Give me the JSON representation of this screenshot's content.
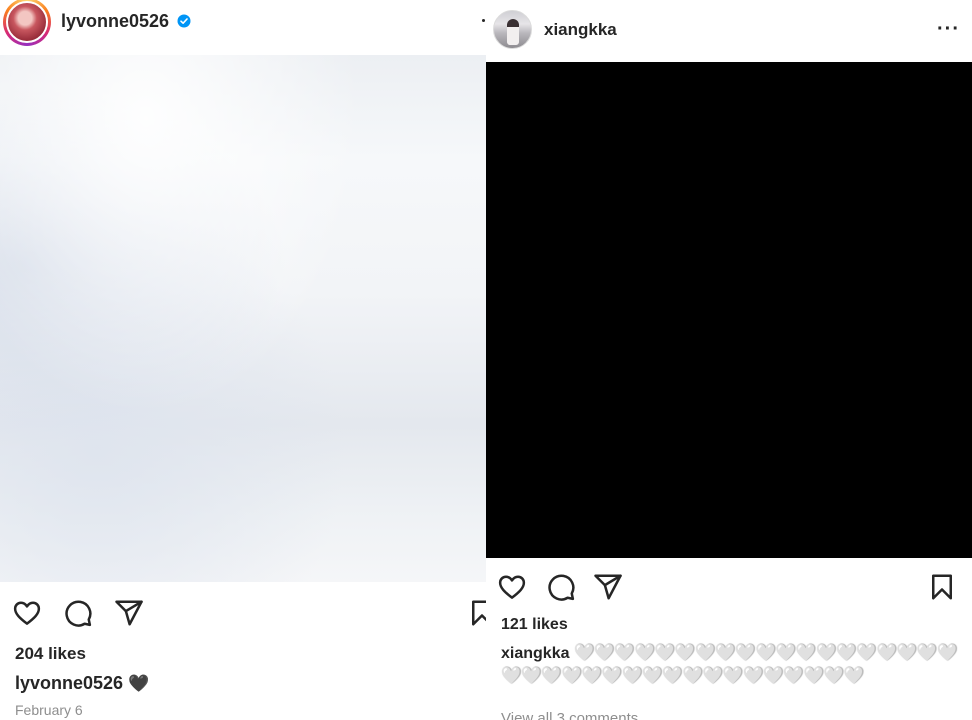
{
  "left_post": {
    "username": "lyvonne0526",
    "verified": true,
    "likes": "204 likes",
    "caption_user": "lyvonne0526",
    "caption_text": "🖤",
    "date": "February 6",
    "icons": [
      "heart-icon",
      "comment-icon",
      "share-icon",
      "bookmark-icon"
    ]
  },
  "right_post": {
    "username": "xiangkka",
    "more_label": "···",
    "likes": "121 likes",
    "caption_user": "xiangkka",
    "caption_text": "🤍🤍🤍🤍🤍🤍🤍🤍🤍🤍🤍🤍🤍🤍🤍🤍🤍🤍🤍🤍🤍🤍🤍🤍🤍🤍🤍🤍🤍🤍🤍🤍🤍🤍🤍🤍🤍",
    "view_comments": "View all 3 comments",
    "icons": [
      "heart-icon",
      "comment-icon",
      "share-icon",
      "bookmark-icon"
    ]
  },
  "colors": {
    "text": "#262626",
    "secondary": "#8e8e8e",
    "verified": "#0095f6"
  }
}
